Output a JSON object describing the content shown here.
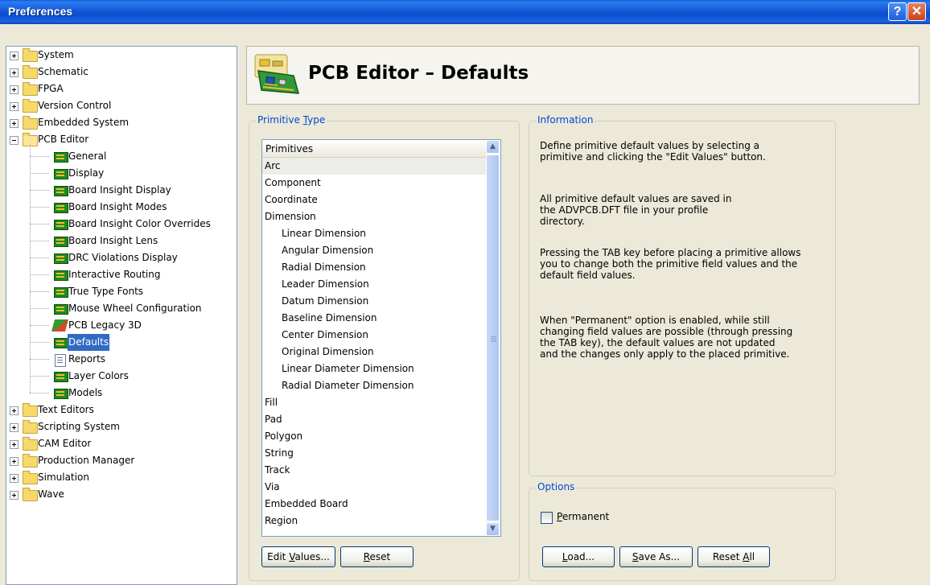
{
  "window": {
    "title": "Preferences",
    "help_glyph": "?",
    "close_glyph": "✕"
  },
  "tree": {
    "top_items_before": [
      "System",
      "Schematic",
      "FPGA",
      "Version Control",
      "Embedded System"
    ],
    "pcb_editor": {
      "label": "PCB Editor",
      "children": [
        {
          "label": "General",
          "icon": "chip-icon"
        },
        {
          "label": "Display",
          "icon": "chip-icon"
        },
        {
          "label": "Board Insight Display",
          "icon": "chip-icon"
        },
        {
          "label": "Board Insight Modes",
          "icon": "chip-icon"
        },
        {
          "label": "Board Insight Color Overrides",
          "icon": "chip-icon"
        },
        {
          "label": "Board Insight Lens",
          "icon": "chip-icon"
        },
        {
          "label": "DRC Violations Display",
          "icon": "chip-icon"
        },
        {
          "label": "Interactive Routing",
          "icon": "chip-icon"
        },
        {
          "label": "True Type Fonts",
          "icon": "chip-icon"
        },
        {
          "label": "Mouse Wheel Configuration",
          "icon": "chip-icon"
        },
        {
          "label": "PCB Legacy 3D",
          "icon": "legacy-3d-icon"
        },
        {
          "label": "Defaults",
          "icon": "chip-icon",
          "selected": true
        },
        {
          "label": "Reports",
          "icon": "document-icon"
        },
        {
          "label": "Layer Colors",
          "icon": "chip-icon"
        },
        {
          "label": "Models",
          "icon": "chip-icon"
        }
      ]
    },
    "top_items_after": [
      "Text Editors",
      "Scripting System",
      "CAM Editor",
      "Production Manager",
      "Simulation",
      "Wave"
    ]
  },
  "header": {
    "title": "PCB Editor – Defaults"
  },
  "primitive_type": {
    "legend": "Primitive Type",
    "column_header": "Primitives",
    "items": [
      {
        "label": "Arc",
        "indent": 0,
        "selected": true
      },
      {
        "label": "Component",
        "indent": 0
      },
      {
        "label": "Coordinate",
        "indent": 0
      },
      {
        "label": "Dimension",
        "indent": 0
      },
      {
        "label": "Linear Dimension",
        "indent": 1
      },
      {
        "label": "Angular Dimension",
        "indent": 1
      },
      {
        "label": "Radial Dimension",
        "indent": 1
      },
      {
        "label": "Leader Dimension",
        "indent": 1
      },
      {
        "label": "Datum Dimension",
        "indent": 1
      },
      {
        "label": "Baseline Dimension",
        "indent": 1
      },
      {
        "label": "Center Dimension",
        "indent": 1
      },
      {
        "label": "Original Dimension",
        "indent": 1
      },
      {
        "label": "Linear Diameter Dimension",
        "indent": 1
      },
      {
        "label": "Radial Diameter Dimension",
        "indent": 1
      },
      {
        "label": "Fill",
        "indent": 0
      },
      {
        "label": "Pad",
        "indent": 0
      },
      {
        "label": "Polygon",
        "indent": 0
      },
      {
        "label": "String",
        "indent": 0
      },
      {
        "label": "Track",
        "indent": 0
      },
      {
        "label": "Via",
        "indent": 0
      },
      {
        "label": "Embedded Board",
        "indent": 0
      },
      {
        "label": "Region",
        "indent": 0
      }
    ],
    "edit_values_button": "Edit Values...",
    "reset_button": "Reset"
  },
  "information": {
    "legend": "Information",
    "paragraphs": [
      [
        "Define primitive default values by selecting a",
        "primitive and clicking the \"Edit Values\" button."
      ],
      [
        "All primitive default values are saved in",
        "the ADVPCB.DFT file in your profile",
        "directory."
      ],
      [
        "Pressing the TAB key before placing a primitive allows",
        "you to change both the primitive field values and the",
        "default field values."
      ],
      [
        "When \"Permanent\" option is enabled, while still",
        "changing field values are possible (through pressing",
        "the TAB key), the default values are not updated",
        "and the changes only apply to the placed primitive."
      ]
    ]
  },
  "options": {
    "legend": "Options",
    "permanent_label": "Permanent",
    "permanent_checked": false,
    "load_button": "Load...",
    "save_as_button": "Save As...",
    "reset_all_button": "Reset All"
  }
}
